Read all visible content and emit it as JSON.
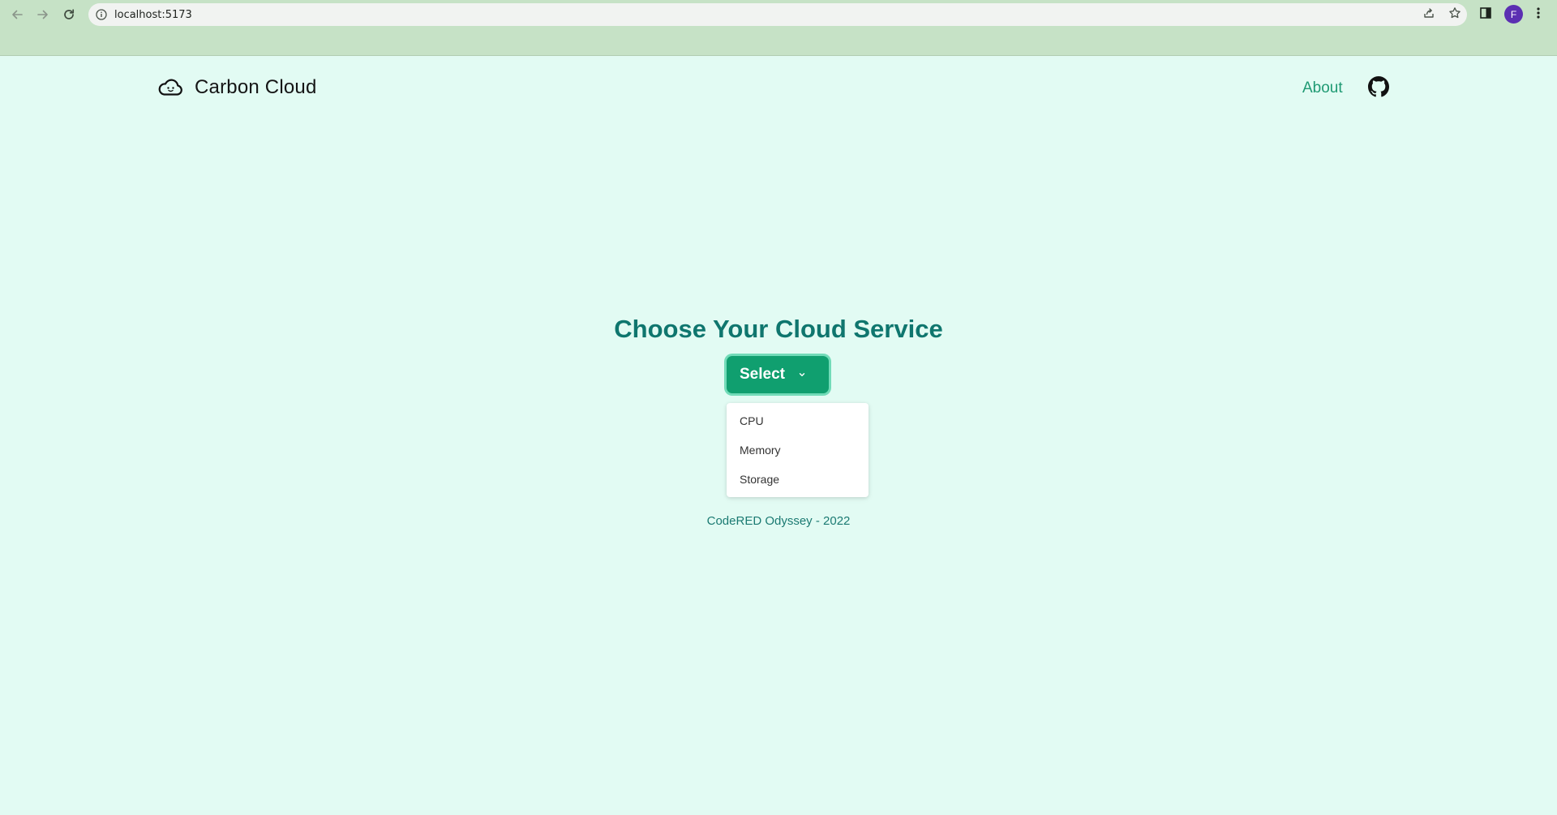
{
  "browser": {
    "url": "localhost:5173",
    "profile_initial": "F",
    "icons": {
      "back": "arrow-left-icon",
      "forward": "arrow-right-icon",
      "reload": "reload-icon",
      "site_info": "info-icon",
      "share": "share-icon",
      "bookmark": "star-icon",
      "side_panel": "side-panel-icon",
      "menu": "kebab-menu-icon"
    }
  },
  "header": {
    "logo_text": "Carbon Cloud",
    "logo_icon": "cloud-icon",
    "about_label": "About",
    "github_icon": "github-icon"
  },
  "main": {
    "title": "Choose Your Cloud Service",
    "select_label": "Select",
    "options": [
      "CPU",
      "Memory",
      "Storage"
    ]
  },
  "footer": {
    "text": "CodeRED Odyssey - 2022"
  },
  "colors": {
    "page_background": "#e2fbf3",
    "chrome_background": "#c6e2c6",
    "title": "#0f766e",
    "button": "#109f6f",
    "button_ring": "#72dbb8",
    "link": "#1f9a73",
    "profile": "#5b2fb2"
  }
}
